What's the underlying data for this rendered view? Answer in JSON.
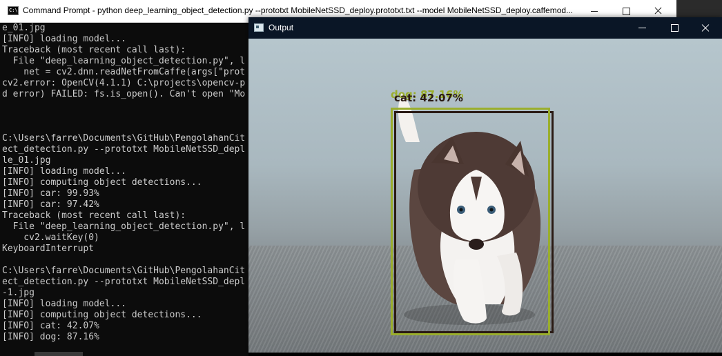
{
  "cmd_window": {
    "title": "Command Prompt - python  deep_learning_object_detection.py --prototxt MobileNetSSD_deploy.prototxt.txt --model MobileNetSSD_deploy.caffemod...",
    "icon": "cmd-icon",
    "icon_text": "C:\\",
    "console_lines": [
      "e_01.jpg",
      "[INFO] loading model...",
      "Traceback (most recent call last):",
      "  File \"deep_learning_object_detection.py\", l",
      "    net = cv2.dnn.readNetFromCaffe(args[\"prot",
      "cv2.error: OpenCV(4.1.1) C:\\projects\\opencv-p",
      "d error) FAILED: fs.is_open(). Can't open \"Mo",
      "",
      "",
      "",
      "C:\\Users\\farre\\Documents\\GitHub\\PengolahanCit",
      "ect_detection.py --prototxt MobileNetSSD_depl",
      "le_01.jpg",
      "[INFO] loading model...",
      "[INFO] computing object detections...",
      "[INFO] car: 99.93%",
      "[INFO] car: 97.42%",
      "Traceback (most recent call last):",
      "  File \"deep_learning_object_detection.py\", l",
      "    cv2.waitKey(0)",
      "KeyboardInterrupt",
      "",
      "C:\\Users\\farre\\Documents\\GitHub\\PengolahanCit",
      "ect_detection.py --prototxt MobileNetSSD_depl",
      "-1.jpg",
      "[INFO] loading model...",
      "[INFO] computing object detections...",
      "[INFO] cat: 42.07%",
      "[INFO] dog: 87.16%"
    ]
  },
  "output_window": {
    "title": "Output",
    "icon": "image-window-icon",
    "detections": [
      {
        "label": "dog: 87.16%",
        "color": "#9aae2c"
      },
      {
        "label": "cat: 42.07%",
        "color": "#2a1a14"
      }
    ]
  }
}
